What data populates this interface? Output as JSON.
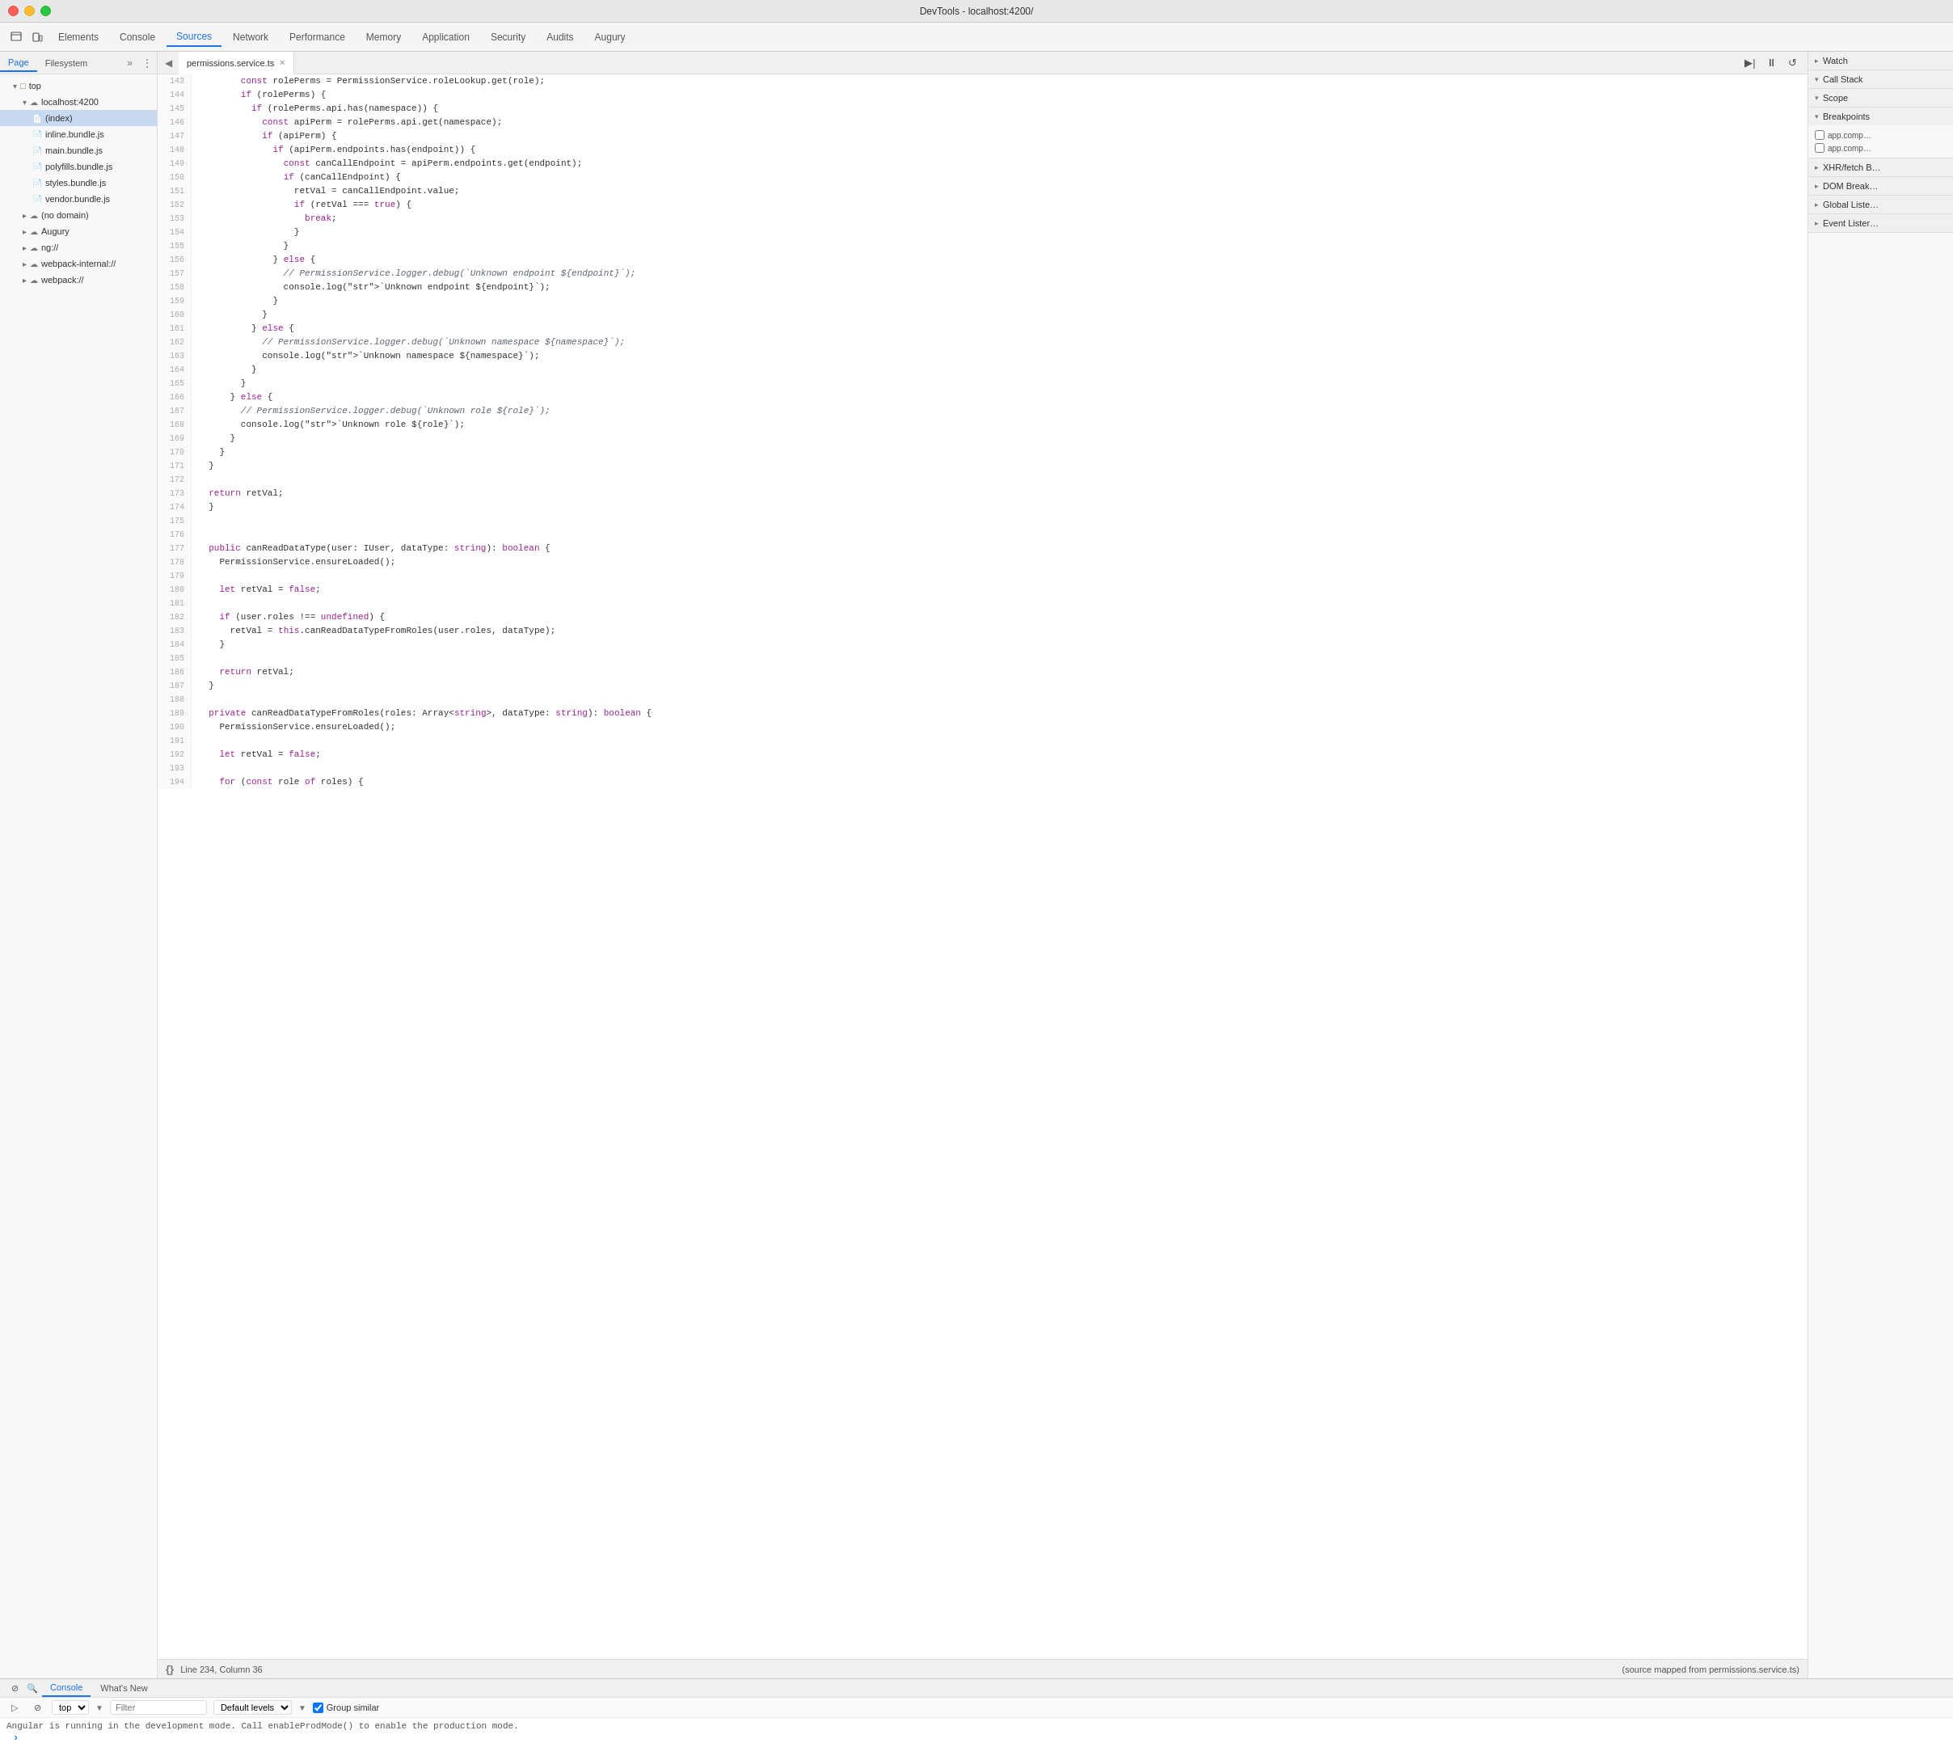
{
  "window": {
    "title": "DevTools - localhost:4200/"
  },
  "nav": {
    "tabs": [
      {
        "label": "Elements",
        "active": false
      },
      {
        "label": "Console",
        "active": false
      },
      {
        "label": "Sources",
        "active": true
      },
      {
        "label": "Network",
        "active": false
      },
      {
        "label": "Performance",
        "active": false
      },
      {
        "label": "Memory",
        "active": false
      },
      {
        "label": "Application",
        "active": false
      },
      {
        "label": "Security",
        "active": false
      },
      {
        "label": "Audits",
        "active": false
      },
      {
        "label": "Augury",
        "active": false
      }
    ]
  },
  "sidebar": {
    "tab_page": "Page",
    "tab_filesystem": "Filesystem",
    "items": [
      {
        "label": "top",
        "type": "folder",
        "indent": 0,
        "expanded": true
      },
      {
        "label": "localhost:4200",
        "type": "cloud",
        "indent": 1,
        "expanded": true
      },
      {
        "label": "(index)",
        "type": "file",
        "indent": 2,
        "selected": true
      },
      {
        "label": "inline.bundle.js",
        "type": "file",
        "indent": 2
      },
      {
        "label": "main.bundle.js",
        "type": "file",
        "indent": 2
      },
      {
        "label": "polyfills.bundle.js",
        "type": "file",
        "indent": 2
      },
      {
        "label": "styles.bundle.js",
        "type": "file",
        "indent": 2
      },
      {
        "label": "vendor.bundle.js",
        "type": "file",
        "indent": 2
      },
      {
        "label": "(no domain)",
        "type": "cloud",
        "indent": 1,
        "expanded": false
      },
      {
        "label": "Augury",
        "type": "cloud",
        "indent": 1,
        "expanded": false
      },
      {
        "label": "ng://",
        "type": "cloud",
        "indent": 1,
        "expanded": false
      },
      {
        "label": "webpack-internal://",
        "type": "cloud",
        "indent": 1,
        "expanded": false
      },
      {
        "label": "webpack://",
        "type": "cloud",
        "indent": 1,
        "expanded": false
      }
    ]
  },
  "editor": {
    "filename": "permissions.service.ts",
    "status_line": "Line 234, Column 36",
    "status_source": "(source mapped from permissions.service.ts)",
    "lines": [
      {
        "num": 143,
        "code": "        const rolePerms = PermissionService.roleLookup.get(role);"
      },
      {
        "num": 144,
        "code": "        if (rolePerms) {"
      },
      {
        "num": 145,
        "code": "          if (rolePerms.api.has(namespace)) {"
      },
      {
        "num": 146,
        "code": "            const apiPerm = rolePerms.api.get(namespace);"
      },
      {
        "num": 147,
        "code": "            if (apiPerm) {"
      },
      {
        "num": 148,
        "code": "              if (apiPerm.endpoints.has(endpoint)) {"
      },
      {
        "num": 149,
        "code": "                const canCallEndpoint = apiPerm.endpoints.get(endpoint);"
      },
      {
        "num": 150,
        "code": "                if (canCallEndpoint) {"
      },
      {
        "num": 151,
        "code": "                  retVal = canCallEndpoint.value;"
      },
      {
        "num": 152,
        "code": "                  if (retVal === true) {"
      },
      {
        "num": 153,
        "code": "                    break;"
      },
      {
        "num": 154,
        "code": "                  }"
      },
      {
        "num": 155,
        "code": "                }"
      },
      {
        "num": 156,
        "code": "              } else {"
      },
      {
        "num": 157,
        "code": "                // PermissionService.logger.debug(`Unknown endpoint ${endpoint}`);"
      },
      {
        "num": 158,
        "code": "                console.log(`Unknown endpoint ${endpoint}`);"
      },
      {
        "num": 159,
        "code": "              }"
      },
      {
        "num": 160,
        "code": "            }"
      },
      {
        "num": 161,
        "code": "          } else {"
      },
      {
        "num": 162,
        "code": "            // PermissionService.logger.debug(`Unknown namespace ${namespace}`);"
      },
      {
        "num": 163,
        "code": "            console.log(`Unknown namespace ${namespace}`);"
      },
      {
        "num": 164,
        "code": "          }"
      },
      {
        "num": 165,
        "code": "        }"
      },
      {
        "num": 166,
        "code": "      } else {"
      },
      {
        "num": 167,
        "code": "        // PermissionService.logger.debug(`Unknown role ${role}`);"
      },
      {
        "num": 168,
        "code": "        console.log(`Unknown role ${role}`);"
      },
      {
        "num": 169,
        "code": "      }"
      },
      {
        "num": 170,
        "code": "    }"
      },
      {
        "num": 171,
        "code": "  }"
      },
      {
        "num": 172,
        "code": ""
      },
      {
        "num": 173,
        "code": "  return retVal;"
      },
      {
        "num": 174,
        "code": "  }"
      },
      {
        "num": 175,
        "code": ""
      },
      {
        "num": 176,
        "code": ""
      },
      {
        "num": 177,
        "code": "  public canReadDataType(user: IUser, dataType: string): boolean {"
      },
      {
        "num": 178,
        "code": "    PermissionService.ensureLoaded();"
      },
      {
        "num": 179,
        "code": ""
      },
      {
        "num": 180,
        "code": "    let retVal = false;"
      },
      {
        "num": 181,
        "code": ""
      },
      {
        "num": 182,
        "code": "    if (user.roles !== undefined) {"
      },
      {
        "num": 183,
        "code": "      retVal = this.canReadDataTypeFromRoles(user.roles, dataType);"
      },
      {
        "num": 184,
        "code": "    }"
      },
      {
        "num": 185,
        "code": ""
      },
      {
        "num": 186,
        "code": "    return retVal;"
      },
      {
        "num": 187,
        "code": "  }"
      },
      {
        "num": 188,
        "code": ""
      },
      {
        "num": 189,
        "code": "  private canReadDataTypeFromRoles(roles: Array<string>, dataType: string): boolean {"
      },
      {
        "num": 190,
        "code": "    PermissionService.ensureLoaded();"
      },
      {
        "num": 191,
        "code": ""
      },
      {
        "num": 192,
        "code": "    let retVal = false;"
      },
      {
        "num": 193,
        "code": ""
      },
      {
        "num": 194,
        "code": "    for (const role of roles) {"
      }
    ]
  },
  "right_panel": {
    "watch_label": "Watch",
    "call_stack_label": "Call Stack",
    "scope_label": "Scope",
    "breakpoints_label": "Breakpoints",
    "breakpoints": [
      {
        "label": "app.comp…",
        "checked": false
      },
      {
        "label": "app.comp…",
        "checked": false
      }
    ],
    "xhr_fetch_label": "XHR/fetch B…",
    "dom_break_label": "DOM Break…",
    "global_listen_label": "Global Liste…",
    "event_listen_label": "Event Lister…"
  },
  "console": {
    "tab_console": "Console",
    "tab_whatsnew": "What's New",
    "filter_placeholder": "Filter",
    "level_label": "Default levels",
    "group_similar_label": "Group similar",
    "context_label": "top",
    "message": "Angular is running in the development mode. Call enableProdMode() to enable the production mode."
  }
}
